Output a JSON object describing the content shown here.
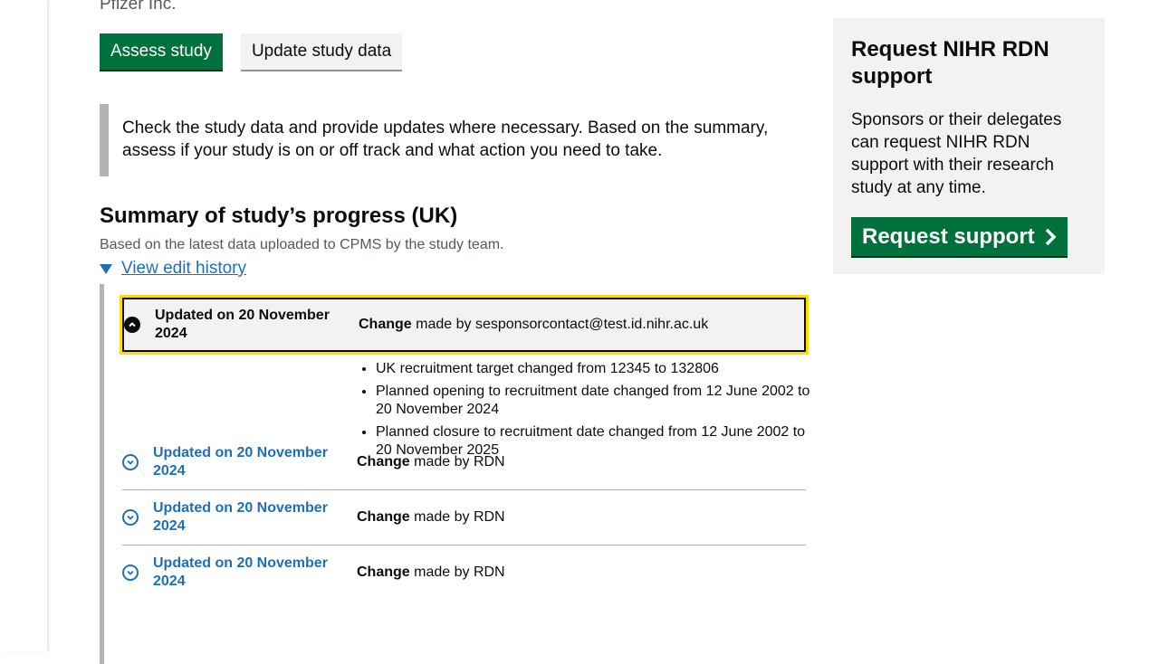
{
  "study": {
    "sponsor": "Pfizer Inc."
  },
  "actions": {
    "assess_label": "Assess study",
    "update_label": "Update study data"
  },
  "inset": {
    "text": "Check the study data and provide updates where necessary. Based on the summary, assess if your study is on or off track and what action you need to take."
  },
  "summary": {
    "title": "Summary of study’s progress (UK)",
    "hint": "Based on the latest data uploaded to CPMS by the study team.",
    "details_label": "View edit history"
  },
  "history": {
    "change_word": "Change",
    "rows": [
      {
        "date": "Updated on 20 November 2024",
        "made_by": "made by sesponsorcontact@test.id.nihr.ac.uk",
        "expanded": true,
        "changes": [
          "UK recruitment target changed from 12345 to 132806",
          "Planned opening to recruitment date changed from 12 June 2002 to 20 November 2024",
          "Planned closure to recruitment date changed from 12 June 2002 to 20 November 2025"
        ]
      },
      {
        "date": "Updated on 20 November 2024",
        "made_by": "made by RDN",
        "expanded": false
      },
      {
        "date": "Updated on 20 November 2024",
        "made_by": "made by RDN",
        "expanded": false
      },
      {
        "date": "Updated on 20 November 2024",
        "made_by": "made by RDN",
        "expanded": false
      }
    ]
  },
  "sidebar": {
    "title": "Request NIHR RDN support",
    "text": "Sponsors or their delegates can request NIHR RDN support with their research study at any time.",
    "button_label": "Request support",
    "button_icon": "chevron-right-icon"
  },
  "colors": {
    "primary_green": "#00703c",
    "link_blue": "#1d70b8",
    "focus_yellow": "#ffdd00",
    "inset_grey": "#b1b4b6",
    "panel_grey": "#f3f2f1"
  }
}
